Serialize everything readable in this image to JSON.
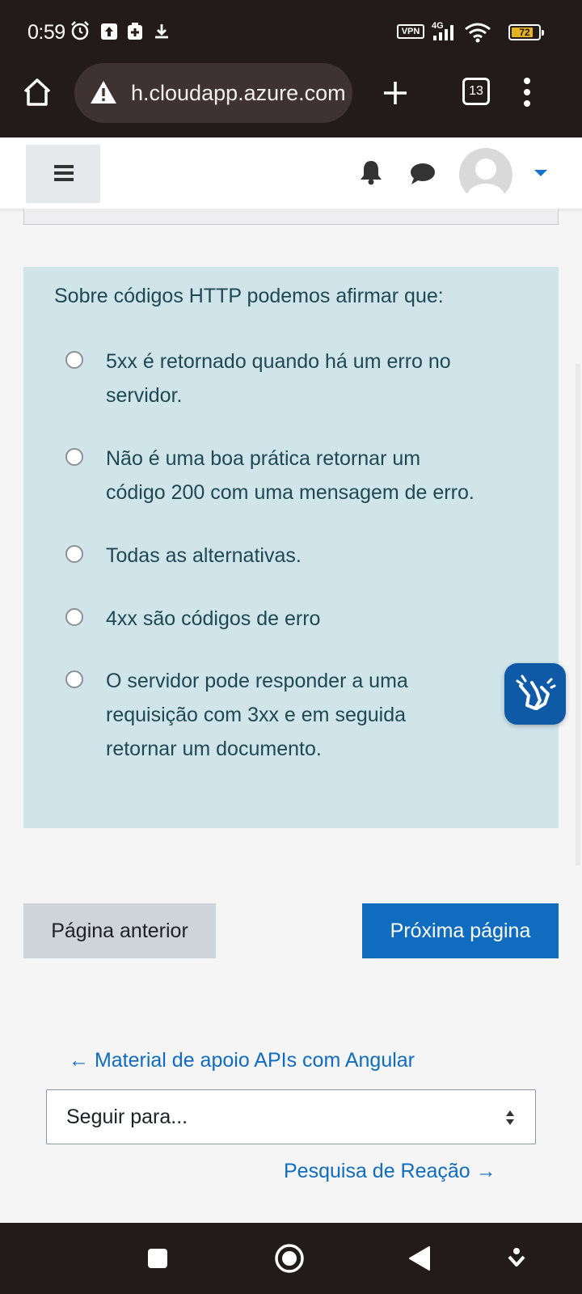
{
  "status_bar": {
    "time": "0:59",
    "vpn_label": "VPN",
    "network_label": "4G",
    "battery_level": "72"
  },
  "browser": {
    "url": "h.cloudapp.azure.com",
    "tab_count": "13"
  },
  "quiz": {
    "question": "Sobre códigos HTTP podemos afirmar que:",
    "options": [
      {
        "line1": "5xx é retornado quando há um erro no",
        "line2": "servidor.",
        "line3": ""
      },
      {
        "line1": "Não é uma boa prática retornar um",
        "line2": "código 200 com uma mensagem de erro.",
        "line3": ""
      },
      {
        "line1": "Todas as alternativas.",
        "line2": "",
        "line3": ""
      },
      {
        "line1": "4xx são códigos de erro",
        "line2": "",
        "line3": ""
      },
      {
        "line1": "O servidor pode responder a uma",
        "line2": "requisição com 3xx e em seguida",
        "line3": "retornar um documento."
      }
    ]
  },
  "buttons": {
    "previous_page": "Página anterior",
    "next_page": "Próxima página"
  },
  "activity_nav": {
    "previous_link": "← Material de apoio APIs com Angular",
    "jump_select": "Seguir para...",
    "next_link": "Pesquisa de Reação →"
  },
  "colors": {
    "question_bg": "#cfe5ea",
    "primary": "#0f6cbf",
    "secondary": "#ced4da",
    "chrome_dark": "#231b1b"
  },
  "icons": {
    "accessibility_widget": "vlibras-hands-icon"
  }
}
